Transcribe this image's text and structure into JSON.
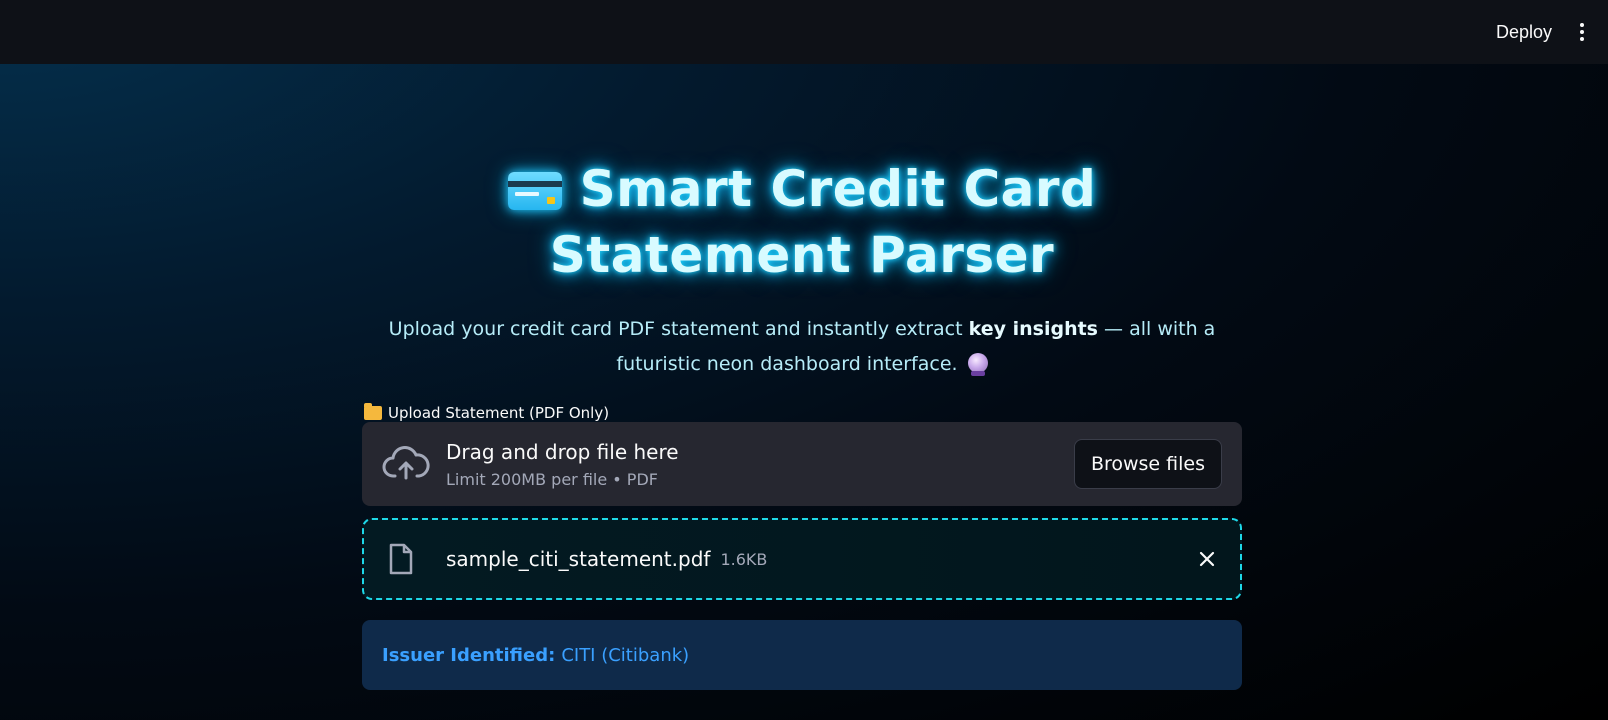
{
  "toolbar": {
    "deploy_label": "Deploy",
    "menu_icon": "vertical-ellipsis-icon"
  },
  "header": {
    "title": "Smart Credit Card Statement Parser",
    "title_icon": "credit-card-icon",
    "subtitle_pre": "Upload your credit card PDF statement and instantly extract ",
    "subtitle_bold": "key insights",
    "subtitle_post": " — all with a futuristic neon dashboard interface.",
    "subtitle_icon": "crystal-ball-icon"
  },
  "uploader": {
    "label": "Upload Statement (PDF Only)",
    "label_icon": "folder-icon",
    "drop_title": "Drag and drop file here",
    "drop_sub": "Limit 200MB per file • PDF",
    "browse_label": "Browse files",
    "cloud_icon": "cloud-upload-icon"
  },
  "file": {
    "name": "sample_citi_statement.pdf",
    "size": "1.6KB",
    "icon": "file-icon",
    "remove_icon": "close-icon"
  },
  "issuer": {
    "label": "Issuer Identified:",
    "value": "CITI (Citibank)"
  },
  "colors": {
    "neon_cyan": "#1ed8e8",
    "info_blue": "#3aa0ff",
    "topbar": "#0e1117"
  }
}
